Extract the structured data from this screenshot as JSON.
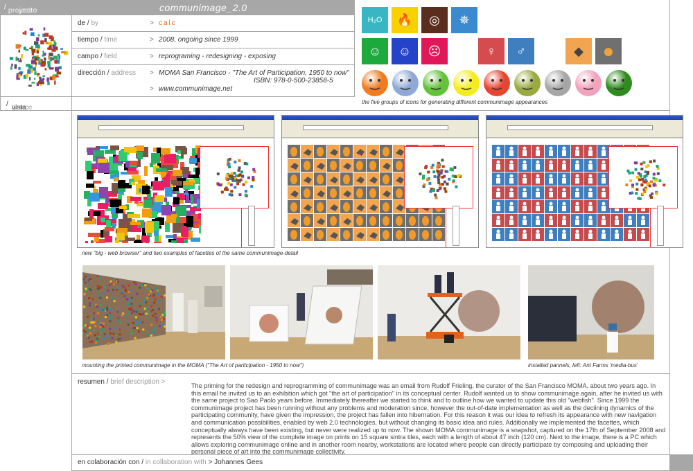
{
  "header": {
    "project_label": "proyecto",
    "project_label_en": "project",
    "title": "communimage_2.0"
  },
  "info": {
    "de": {
      "label": "de",
      "label_en": "by",
      "value": "calc"
    },
    "tiempo": {
      "label": "tiempo",
      "label_en": "time",
      "value": "2008, ongoing since 1999"
    },
    "campo": {
      "label": "campo",
      "label_en": "field",
      "value": "reprograming - redesigning - exposing"
    },
    "direccion": {
      "label": "dirección",
      "label_en": "address",
      "value": "MOMA San Francisco - \"The Art of Participation, 1950 to now\"",
      "isbn": "ISBN: 978-0-500-23858-5",
      "url": "www.communimage.net"
    },
    "arrow": ">"
  },
  "icons": {
    "caption": "the five groups of icons for generating different communimage appearances",
    "row1": [
      {
        "name": "water-icon",
        "bg": "#3ab5c4",
        "glyph": "H₂O"
      },
      {
        "name": "fire-icon",
        "bg": "#f7d200",
        "glyph": "🔥"
      },
      {
        "name": "globe-icon",
        "bg": "#5a2d1f",
        "glyph": "◎"
      },
      {
        "name": "fan-icon",
        "bg": "#3b8ad0",
        "glyph": "✵"
      }
    ],
    "row2": [
      {
        "name": "happy-icon",
        "bg": "#1ea93d",
        "glyph": "☺"
      },
      {
        "name": "neutral-icon",
        "bg": "#2543c9",
        "glyph": "☺"
      },
      {
        "name": "angry-icon",
        "bg": "#e0185a",
        "glyph": "☹"
      },
      {
        "name": "woman-icon",
        "bg": "#d44c4f",
        "glyph": "♀"
      },
      {
        "name": "man-icon",
        "bg": "#3f7fbf",
        "glyph": "♂"
      },
      {
        "name": "bird-icon",
        "bg": "#f2a551",
        "glyph": "◆"
      },
      {
        "name": "egg-icon",
        "bg": "#707070",
        "glyph": "●"
      }
    ],
    "faces": [
      {
        "name": "face-orange-icon",
        "color": "#f07b21"
      },
      {
        "name": "face-blue-icon",
        "color": "#8ea9d6"
      },
      {
        "name": "face-green-icon",
        "color": "#64c33b"
      },
      {
        "name": "face-yellow-icon",
        "color": "#f5ec1e"
      },
      {
        "name": "face-red-icon",
        "color": "#e84531"
      },
      {
        "name": "face-olive-icon",
        "color": "#9aaa41"
      },
      {
        "name": "face-gray-icon",
        "color": "#a6a6a6"
      },
      {
        "name": "face-pink-icon",
        "color": "#f3a2bd"
      },
      {
        "name": "face-darkgreen-icon",
        "color": "#2e8b1d"
      }
    ]
  },
  "vista": {
    "label": "vista",
    "label_en": "glance"
  },
  "browsers_caption": "new \"big - web browser\" and two examples of facettes of the same communimage-detail",
  "photos_caption_1": "mounting the printed communimage in the MOMA (\"The Art of participation - 1950 to now\")",
  "photos_caption_2": "installed pannels, left: Ant Farms 'media-bus'",
  "resumen": {
    "label": "resumen",
    "label_en": "brief description",
    "arrow": ">",
    "text": "The priming for the redesign and reprogramming of communimage was an email from Rudolf Frieling, the curator of the San Francisco MOMA, about two years ago. In this email he invited us to an exhibition which got \"the art of participation\" in its conceptual center. Rudolf wanted us to show communimage again, after he invited us with the same project to Sao Paolo years before. Immediately thereafter we started to think and to outline how we wanted to update this old \"webfish\". Since 1999 the communimage project has been running without any problems and moderation since, however the out-of-date implementation as well as the declining dynamics of the participating community, have given the impression, the project has fallen into hibernation.  For this reason it was our idea to refresh its appearance with new navigation and communication possibilities, enabled by web 2.0 technologies, but without changing its basic idea and rules. Additionally we implemented the facettes, which conceptually always have been existing, but never were realized up to now. The shown MOMA communimage is a snapshot, captured on the 17th of September 2008 and represents the 50% view of the complete image on prints on 15 square sintra tiles, each with a length of about 47 inch (120 cm). Next to the image, there is a PC which allows exploring communimage online and in another room nearby, workstations are located where people can directly participate by composing and uploading their personal piece of art into the communimage collectivity."
  },
  "collab": {
    "label": "en colaboración con",
    "label_en": "in collaboration with",
    "arrow": ">",
    "value": "Johannes Gees"
  }
}
